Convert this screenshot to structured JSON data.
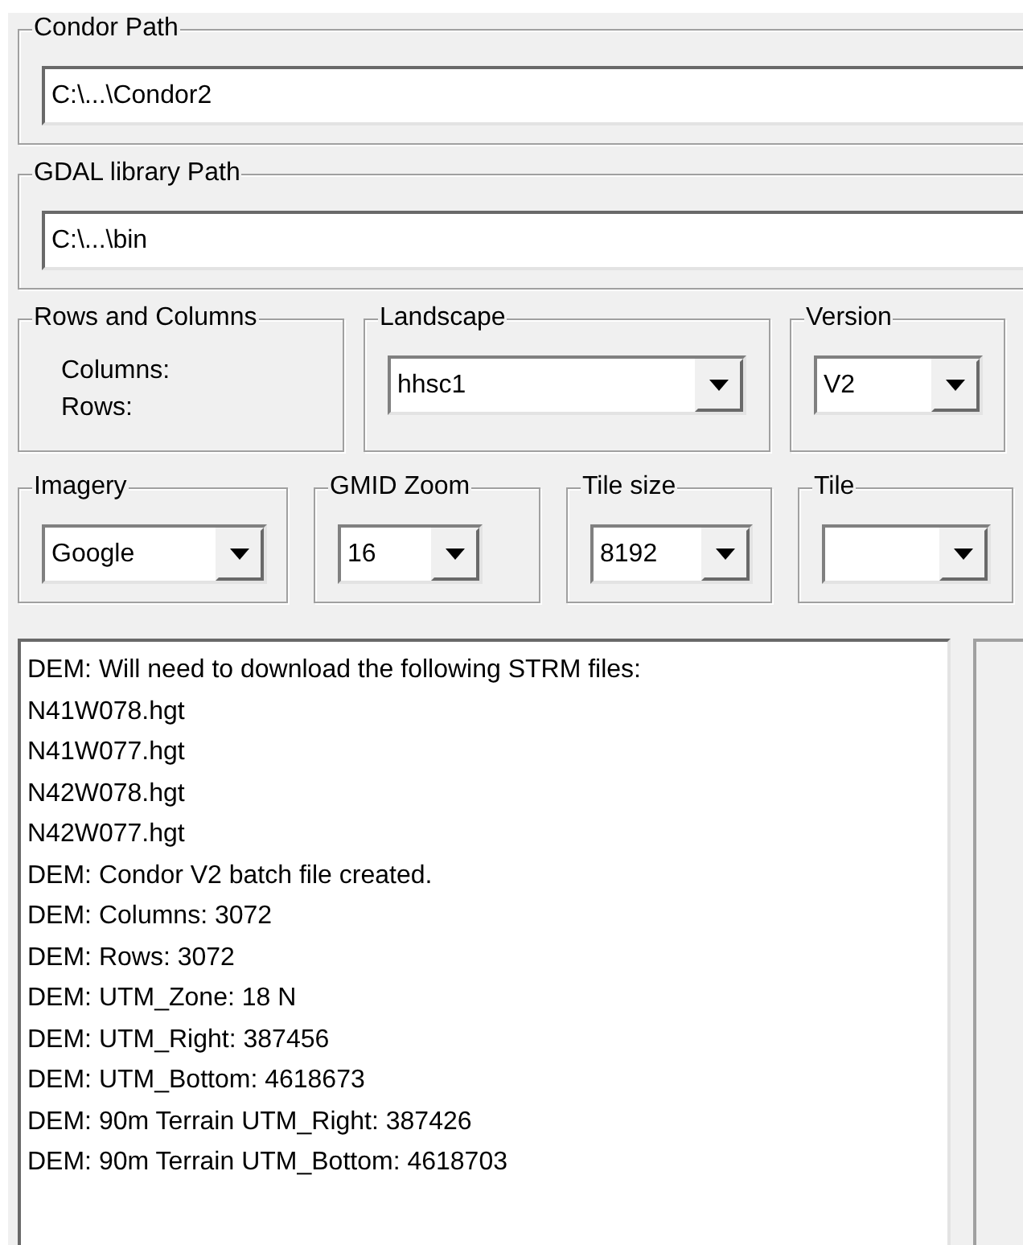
{
  "condor_path": {
    "label": "Condor Path",
    "value": "C:\\...\\Condor2"
  },
  "gdal_path": {
    "label": "GDAL library Path",
    "value": "C:\\...\\bin"
  },
  "rows_and_columns": {
    "label": "Rows and Columns",
    "columns_label": "Columns:",
    "rows_label": "Rows:"
  },
  "landscape": {
    "label": "Landscape",
    "value": "hhsc1"
  },
  "version": {
    "label": "Version",
    "value": "V2"
  },
  "imagery": {
    "label": "Imagery",
    "value": "Google"
  },
  "gmid_zoom": {
    "label": "GMID Zoom",
    "value": "16"
  },
  "tile_size": {
    "label": "Tile size",
    "value": "8192"
  },
  "tile": {
    "label": "Tile"
  },
  "log": [
    "DEM: Will need to download the following STRM files:",
    "N41W078.hgt",
    "N41W077.hgt",
    "N42W078.hgt",
    "N42W077.hgt",
    "DEM: Condor V2 batch file created.",
    "DEM: Columns: 3072",
    "DEM: Rows: 3072",
    "DEM: UTM_Zone: 18 N",
    "DEM: UTM_Right: 387456",
    "DEM: UTM_Bottom: 4618673",
    "DEM: 90m Terrain UTM_Right: 387426",
    "DEM: 90m Terrain UTM_Bottom: 4618703"
  ]
}
